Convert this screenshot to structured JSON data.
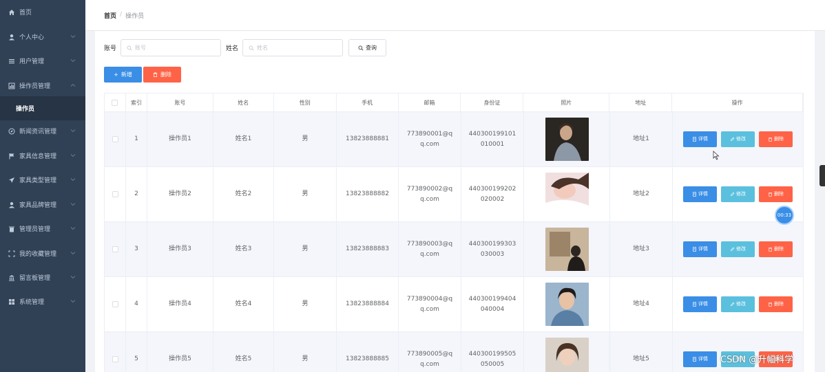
{
  "sidebar": {
    "items": [
      {
        "label": "首页",
        "icon": "home-icon",
        "has_children": false
      },
      {
        "label": "个人中心",
        "icon": "user-icon",
        "has_children": true
      },
      {
        "label": "用户管理",
        "icon": "list-icon",
        "has_children": true
      },
      {
        "label": "操作员管理",
        "icon": "chart-icon",
        "has_children": true,
        "expanded": true
      },
      {
        "label": "操作员",
        "icon": "",
        "sub": true
      },
      {
        "label": "新闻资讯管理",
        "icon": "compass-icon",
        "has_children": true
      },
      {
        "label": "家具信息管理",
        "icon": "flag-icon",
        "has_children": true
      },
      {
        "label": "家具类型管理",
        "icon": "send-icon",
        "has_children": true
      },
      {
        "label": "家具品牌管理",
        "icon": "user-icon",
        "has_children": true
      },
      {
        "label": "管理员管理",
        "icon": "trash-icon",
        "has_children": true
      },
      {
        "label": "我的收藏管理",
        "icon": "frame-icon",
        "has_children": true
      },
      {
        "label": "留言板管理",
        "icon": "bank-icon",
        "has_children": true
      },
      {
        "label": "系统管理",
        "icon": "grid-icon",
        "has_children": true
      }
    ]
  },
  "breadcrumb": {
    "home": "首页",
    "sep": "/",
    "current": "操作员"
  },
  "search": {
    "account_label": "账号",
    "account_placeholder": "账号",
    "name_label": "姓名",
    "name_placeholder": "姓名",
    "query_label": "查询"
  },
  "actions": {
    "add_label": "新增",
    "delete_label": "删除"
  },
  "table": {
    "headers": [
      "",
      "索引",
      "账号",
      "姓名",
      "性别",
      "手机",
      "邮箱",
      "身份证",
      "照片",
      "地址",
      "操作"
    ],
    "rows": [
      {
        "index": "1",
        "account": "操作员1",
        "name": "姓名1",
        "gender": "男",
        "phone": "13823888881",
        "email": "773890001@qq.com",
        "id_card": "440300199101010001",
        "address": "地址1"
      },
      {
        "index": "2",
        "account": "操作员2",
        "name": "姓名2",
        "gender": "男",
        "phone": "13823888882",
        "email": "773890002@qq.com",
        "id_card": "440300199202020002",
        "address": "地址2"
      },
      {
        "index": "3",
        "account": "操作员3",
        "name": "姓名3",
        "gender": "男",
        "phone": "13823888883",
        "email": "773890003@qq.com",
        "id_card": "440300199303030003",
        "address": "地址3"
      },
      {
        "index": "4",
        "account": "操作员4",
        "name": "姓名4",
        "gender": "男",
        "phone": "13823888884",
        "email": "773890004@qq.com",
        "id_card": "440300199404040004",
        "address": "地址4"
      },
      {
        "index": "5",
        "account": "操作员5",
        "name": "姓名5",
        "gender": "男",
        "phone": "13823888885",
        "email": "773890005@qq.com",
        "id_card": "440300199505050005",
        "address": "地址5"
      }
    ],
    "op_labels": {
      "detail": "详情",
      "edit": "修改",
      "remove": "删除"
    }
  },
  "overlay": {
    "timer": "00:33",
    "watermark": "CSDN @升幅科学"
  },
  "colors": {
    "sidebar": "#304156",
    "primary": "#3a8ee6",
    "info": "#5bc0de",
    "danger": "#ff6347"
  }
}
